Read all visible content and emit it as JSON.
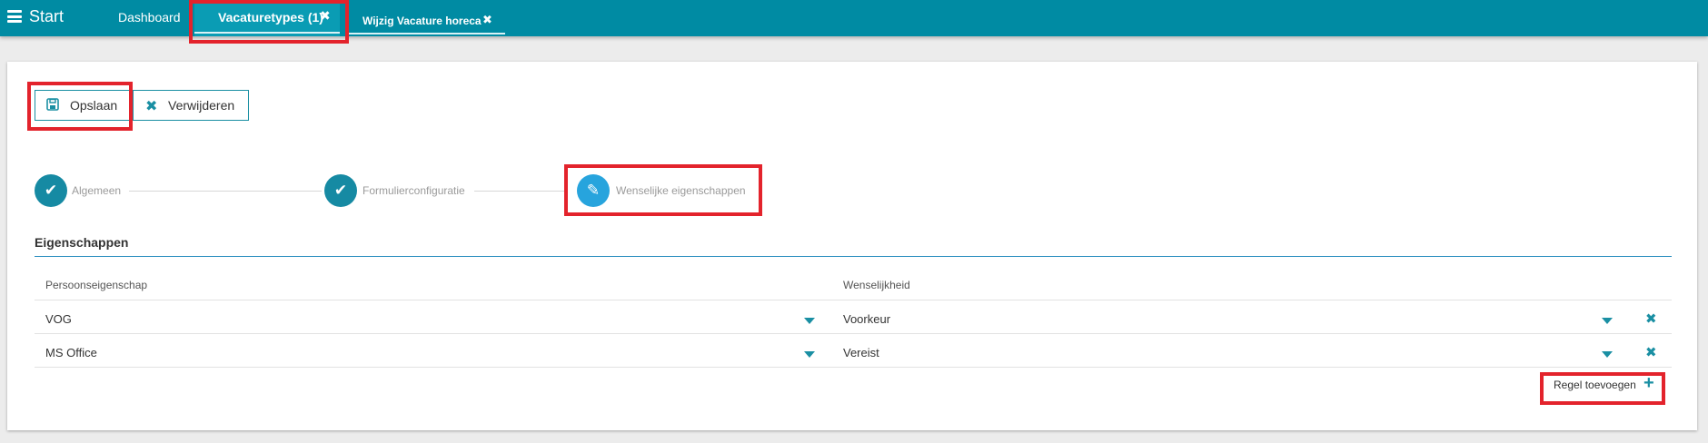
{
  "topbar": {
    "start_label": "Start",
    "menu_icon": "hamburger-icon",
    "tabs": [
      {
        "label": "Dashboard"
      },
      {
        "label": "Vacaturetypes (1)",
        "close": "✖"
      },
      {
        "label": "Wijzig Vacature horeca",
        "close": "✖"
      }
    ]
  },
  "toolbar": {
    "save_label": "Opslaan",
    "delete_label": "Verwijderen",
    "delete_icon": "✖"
  },
  "stepper": {
    "steps": [
      {
        "label": "Algemeen",
        "state": "done",
        "icon": "✔"
      },
      {
        "label": "Formulierconfiguratie",
        "state": "done",
        "icon": "✔"
      },
      {
        "label": "Wenselijke eigenschappen",
        "state": "active",
        "icon": "✎"
      }
    ]
  },
  "section": {
    "title": "Eigenschappen",
    "columns": [
      "Persoonseigenschap",
      "Wenselijkheid"
    ],
    "rows": [
      {
        "eigenschap": "VOG",
        "wenselijkheid": "Voorkeur"
      },
      {
        "eigenschap": "MS Office",
        "wenselijkheid": "Vereist"
      }
    ],
    "remove_icon": "✖",
    "add_label": "Regel toevoegen",
    "add_icon": "+"
  },
  "colors": {
    "topbar": "#008ba3",
    "accent": "#1a8fa3",
    "active_step": "#27a4dd",
    "highlight": "#e3232c"
  }
}
